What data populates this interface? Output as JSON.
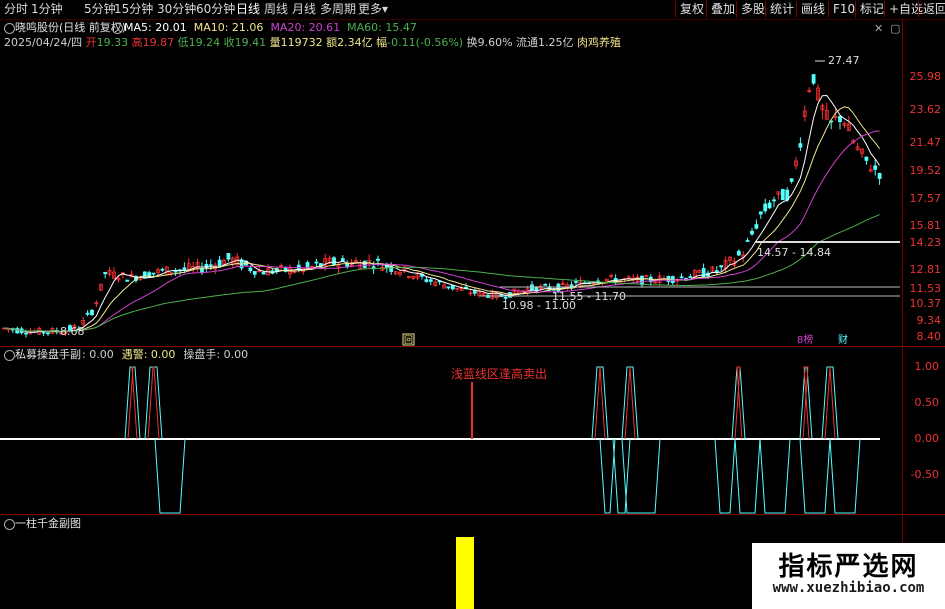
{
  "toolbar": {
    "periods": [
      {
        "label": "分时",
        "x": 4
      },
      {
        "label": "1分钟",
        "x": 31
      },
      {
        "label": "5分钟",
        "x": 84
      },
      {
        "label": "15分钟",
        "x": 114
      },
      {
        "label": "30分钟",
        "x": 157
      },
      {
        "label": "60分钟",
        "x": 196
      },
      {
        "label": "日线",
        "x": 236
      },
      {
        "label": "周线",
        "x": 264
      },
      {
        "label": "月线",
        "x": 292
      },
      {
        "label": "多周期",
        "x": 320
      },
      {
        "label": "更多",
        "x": 358
      }
    ],
    "more_arrow": "▾",
    "right_buttons": [
      {
        "label": "复权",
        "x": 675
      },
      {
        "label": "叠加",
        "x": 706
      },
      {
        "label": "多股",
        "x": 736
      },
      {
        "label": "统计",
        "x": 765
      },
      {
        "label": "画线",
        "x": 796
      },
      {
        "label": "F10",
        "x": 828
      },
      {
        "label": "标记",
        "x": 855
      },
      {
        "label": "+自选",
        "x": 884
      },
      {
        "label": "返回",
        "x": 918
      }
    ]
  },
  "main_chart": {
    "title": "晓鸣股份(日线 前复权)",
    "ma": [
      {
        "label": "MA5: 20.01",
        "color": "#ffffff"
      },
      {
        "label": "MA10: 21.06",
        "color": "#f0e68c"
      },
      {
        "label": "MA20: 20.61",
        "color": "#d040d0"
      },
      {
        "label": "MA60: 15.47",
        "color": "#4caf50"
      }
    ],
    "quote": {
      "date": "2025/04/24/四",
      "open_label": "开",
      "open": "19.33",
      "high_label": "高",
      "high": "19.87",
      "low_label": "低",
      "low": "19.24",
      "close_label": "收",
      "close": "19.41",
      "vol_label": "量",
      "vol": "119732",
      "amt_label": "额",
      "amt": "2.34亿",
      "chg_label": "幅",
      "chg": "-0.11(-0.56%)",
      "turn_label": "换",
      "turn": "9.60%",
      "float_label": "流通",
      "float": "1.25亿",
      "sector": "肉鸡养殖"
    },
    "y_ticks": [
      "25.98",
      "23.62",
      "21.47",
      "19.52",
      "17.57",
      "15.81",
      "14.23",
      "12.81",
      "11.53",
      "10.37",
      "9.34",
      "8.40"
    ],
    "annotations": {
      "high": "27.47",
      "low": "8.68",
      "range1": "14.57 - 14.84",
      "range2": "11.55 - 11.70",
      "range3": "10.98 - 11.00"
    },
    "markers": [
      "回",
      "8榜",
      "财"
    ],
    "colors": {
      "up": "#ff3232",
      "down": "#54ffff",
      "ma5": "#ffffff",
      "ma10": "#f0e68c",
      "ma20": "#d040d0",
      "ma60": "#4caf50"
    }
  },
  "indicator1": {
    "title": "私募操盘手副",
    "values": [
      {
        "label": ": 0.00",
        "color": "#cfcfcf"
      },
      {
        "label": "遇警: 0.00",
        "color": "#f0e68c"
      },
      {
        "label": "操盘手: 0.00",
        "color": "#cfcfcf"
      }
    ],
    "annotation": "浅蓝线区逢高卖出",
    "y_ticks": [
      "1.00",
      "0.50",
      "0.00",
      "-0.50"
    ]
  },
  "indicator2": {
    "title": "一柱千金副图"
  },
  "watermark": {
    "cn": "指标严选网",
    "url": "www.xuezhibiao.com"
  }
}
